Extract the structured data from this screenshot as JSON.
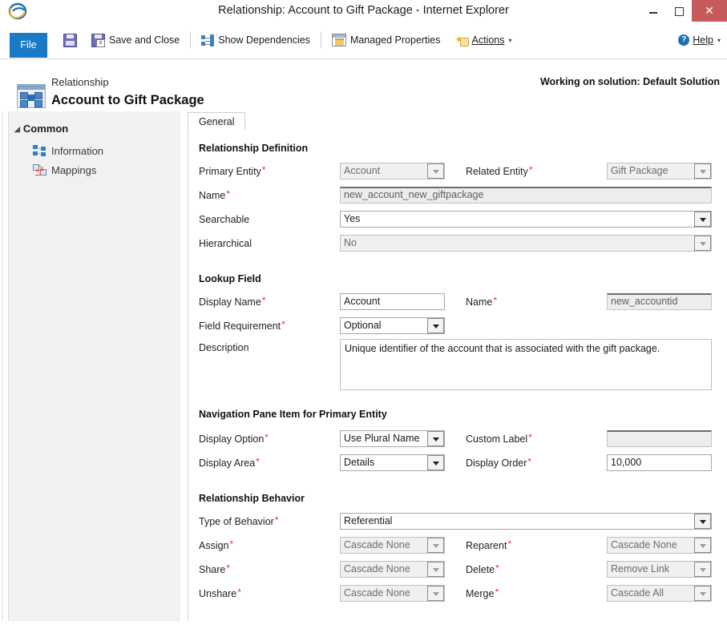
{
  "window": {
    "title": "Relationship: Account to Gift Package - Internet Explorer",
    "app_icon": "internet-explorer-icon",
    "minimize_label": "–",
    "maximize_label": "□",
    "close_label": "✕"
  },
  "ribbon": {
    "file_label": "File",
    "commands": [
      {
        "label": "",
        "icon": "save-icon"
      },
      {
        "label": "Save and Close",
        "icon": "save-and-close-icon"
      },
      {
        "label": "Show Dependencies",
        "icon": "dependencies-icon"
      },
      {
        "label": "Managed Properties",
        "icon": "managed-properties-icon"
      },
      {
        "label": "Actions",
        "icon": "actions-icon",
        "caret": "▾"
      }
    ],
    "help_label": "Help",
    "help_caret": "▾",
    "help_icon": "help-icon"
  },
  "header": {
    "entity_type": "Relationship",
    "title": "Account to Gift Package",
    "solution_text": "Working on solution: Default Solution",
    "icon": "relationship-icon"
  },
  "sidebar": {
    "group_label": "Common",
    "group_arrow": "◢",
    "items": [
      {
        "label": "Information",
        "icon": "information-icon"
      },
      {
        "label": "Mappings",
        "icon": "mappings-icon"
      }
    ]
  },
  "tabs": [
    {
      "label": "General",
      "selected": true
    }
  ],
  "form": {
    "sections": {
      "relationship_definition": {
        "title": "Relationship Definition",
        "primary_entity_label": "Primary Entity",
        "primary_entity_value": "Account",
        "related_entity_label": "Related Entity",
        "related_entity_value": "Gift Package",
        "name_label": "Name",
        "name_value": "new_account_new_giftpackage",
        "searchable_label": "Searchable",
        "searchable_value": "Yes",
        "hierarchical_label": "Hierarchical",
        "hierarchical_value": "No"
      },
      "lookup_field": {
        "title": "Lookup Field",
        "display_name_label": "Display Name",
        "display_name_value": "Account",
        "name_label": "Name",
        "name_value": "new_accountid",
        "field_requirement_label": "Field Requirement",
        "field_requirement_value": "Optional",
        "description_label": "Description",
        "description_value": "Unique identifier of the account that is associated with the gift package."
      },
      "navigation_pane": {
        "title": "Navigation Pane Item for Primary Entity",
        "display_option_label": "Display Option",
        "display_option_value": "Use Plural Name",
        "custom_label_label": "Custom Label",
        "custom_label_value": "",
        "display_area_label": "Display Area",
        "display_area_value": "Details",
        "display_order_label": "Display Order",
        "display_order_value": "10,000"
      },
      "relationship_behavior": {
        "title": "Relationship Behavior",
        "type_of_behavior_label": "Type of Behavior",
        "type_of_behavior_value": "Referential",
        "assign_label": "Assign",
        "assign_value": "Cascade None",
        "reparent_label": "Reparent",
        "reparent_value": "Cascade None",
        "share_label": "Share",
        "share_value": "Cascade None",
        "delete_label": "Delete",
        "delete_value": "Remove Link",
        "unshare_label": "Unshare",
        "unshare_value": "Cascade None",
        "merge_label": "Merge",
        "merge_value": "Cascade All"
      }
    },
    "required_marker": "*"
  },
  "colors": {
    "file_tab": "#1a7ac7",
    "close_button": "#c75b5b",
    "required_asterisk": "#e03b24",
    "sidebar_bg": "#f1f1f1"
  }
}
